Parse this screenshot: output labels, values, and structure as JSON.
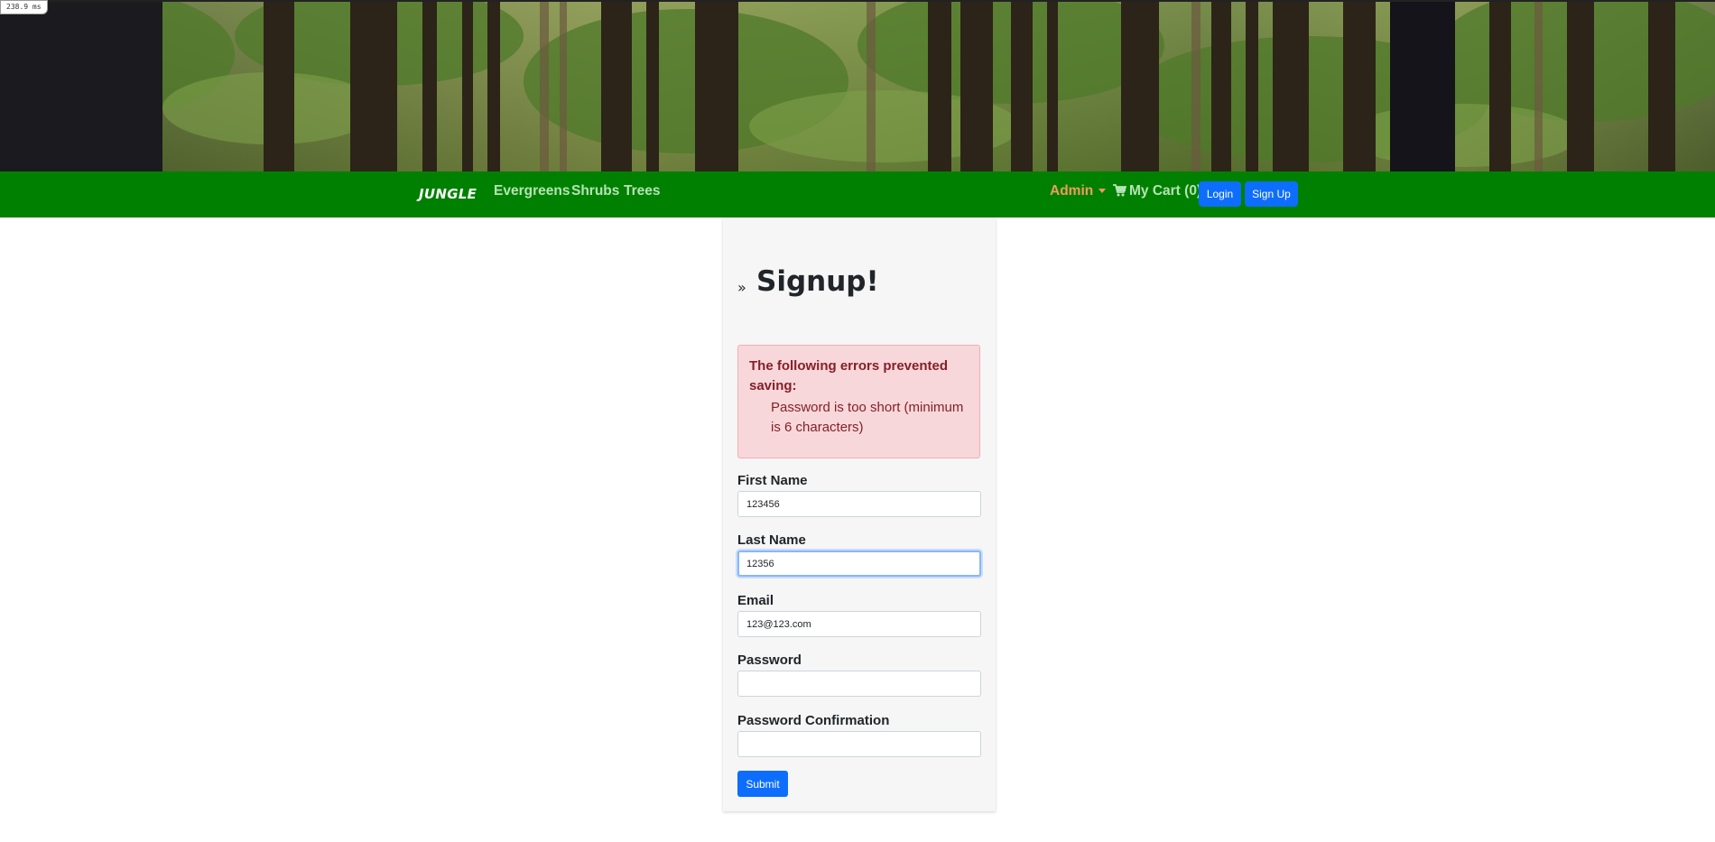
{
  "perf": {
    "timing_label": "238.9 ms"
  },
  "nav": {
    "brand": "JUNGLE",
    "links": [
      "Evergreens",
      "Shrubs",
      "Trees"
    ],
    "admin_label": "Admin",
    "cart_label": "My Cart (0)",
    "login_label": "Login",
    "signup_label": "Sign Up",
    "icons": {
      "cart": "shopping-cart-icon",
      "admin_dropdown": "caret-down-icon"
    }
  },
  "page": {
    "raquo": "»",
    "title": "Signup!"
  },
  "errors": {
    "heading": "The following errors prevented saving:",
    "items": [
      "Password is too short (minimum is 6 characters)"
    ]
  },
  "form": {
    "first_name": {
      "label": "First Name",
      "value": "123456"
    },
    "last_name": {
      "label": "Last Name",
      "value": "12356"
    },
    "email": {
      "label": "Email",
      "value": "123@123.com"
    },
    "password": {
      "label": "Password",
      "value": ""
    },
    "password_confirmation": {
      "label": "Password Confirmation",
      "value": ""
    },
    "submit_label": "Submit"
  },
  "colors": {
    "navbar": "#008000",
    "nav_link": "#b6e3b4",
    "admin": "#f39a5e",
    "primary_button": "#0d6efd",
    "alert_bg": "#f8d7da",
    "alert_text": "#842029"
  }
}
